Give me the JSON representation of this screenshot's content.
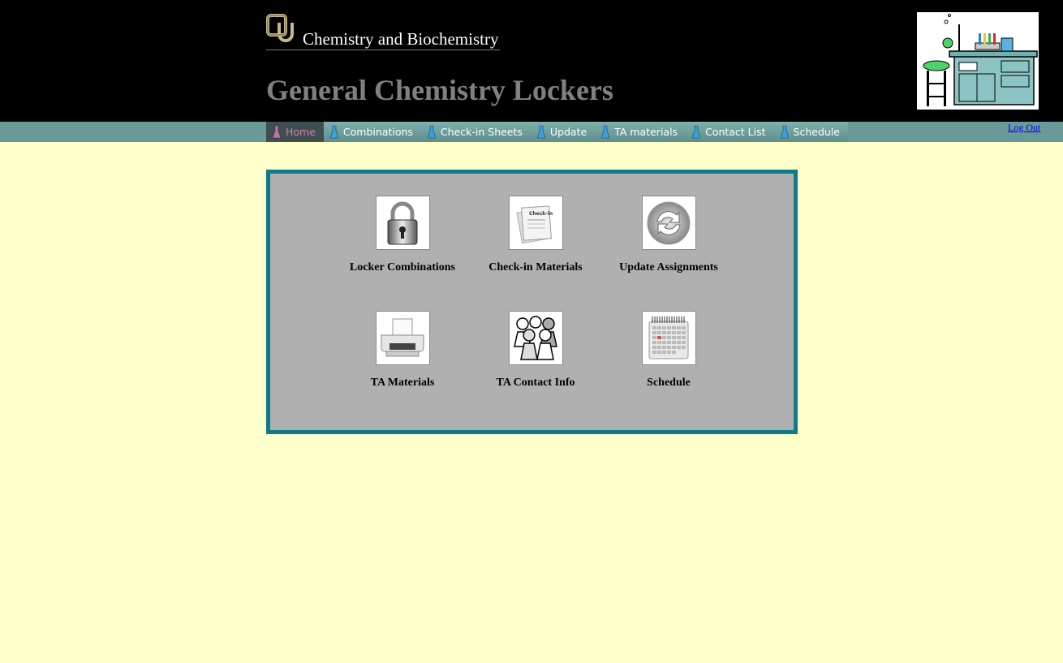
{
  "header": {
    "department": "Chemistry and Biochemistry",
    "title": "General Chemistry Lockers"
  },
  "nav": {
    "items": [
      {
        "label": "Home",
        "active": true
      },
      {
        "label": "Combinations"
      },
      {
        "label": "Check-in Sheets"
      },
      {
        "label": "Update"
      },
      {
        "label": "TA materials"
      },
      {
        "label": "Contact List"
      },
      {
        "label": "Schedule"
      }
    ],
    "logout": "Log Out"
  },
  "panel": {
    "tiles": [
      {
        "label": "Locker Combinations",
        "icon": "padlock-icon"
      },
      {
        "label": "Check-in Materials",
        "icon": "check-in-sheet-icon",
        "icon_text": "Check-in"
      },
      {
        "label": "Update Assignments",
        "icon": "refresh-icon"
      },
      {
        "label": "TA Materials",
        "icon": "printer-icon"
      },
      {
        "label": "TA Contact Info",
        "icon": "people-icon"
      },
      {
        "label": "Schedule",
        "icon": "calendar-icon"
      }
    ]
  },
  "colors": {
    "background": "#ffffcc",
    "header": "#000000",
    "navbar": "#6a9a98",
    "panel": "#b0b0b0",
    "panel_border": "#0e7a8a",
    "title": "#808080"
  }
}
